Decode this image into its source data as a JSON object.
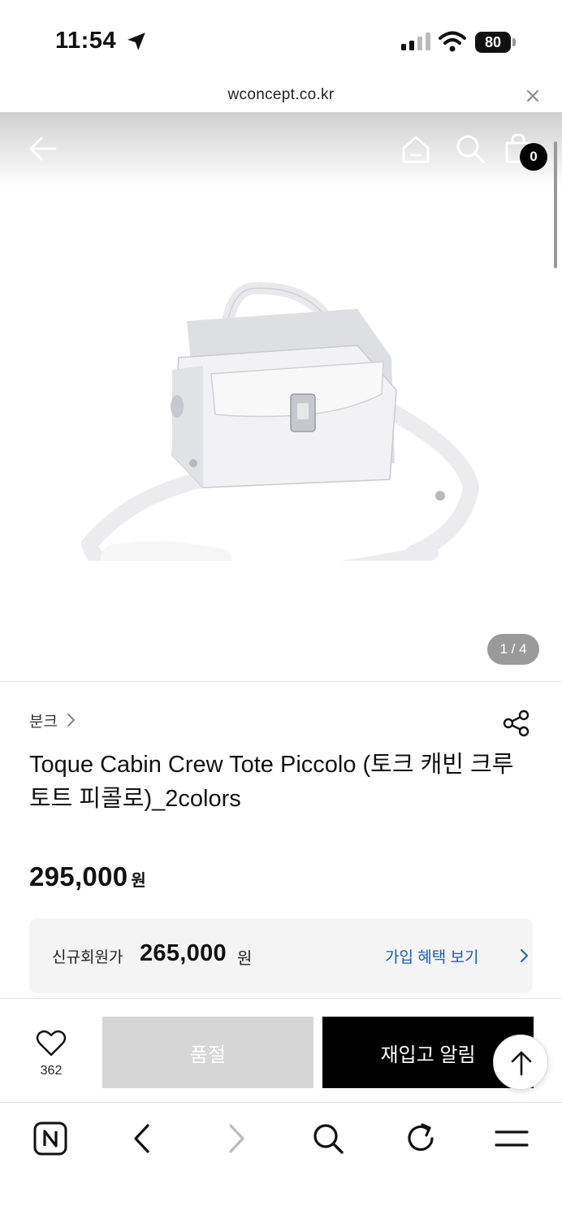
{
  "status_bar": {
    "time": "11:54",
    "battery": "80"
  },
  "browser": {
    "url": "wconcept.co.kr"
  },
  "nav": {
    "cart_count": "0"
  },
  "gallery": {
    "page_indicator": "1 / 4",
    "current_index": 1,
    "total": 4
  },
  "product": {
    "brand": "분크",
    "title": "Toque Cabin Crew Tote Piccolo (토크 캐빈 크루 토트 피콜로)_2colors",
    "price": "295,000",
    "price_unit": "원",
    "member_label": "신규회원가",
    "member_price": "265,000",
    "member_unit": "원",
    "member_link": "가입 혜택 보기"
  },
  "actions": {
    "wish_count": "362",
    "soldout_label": "품절",
    "restock_label": "재입고 알림"
  },
  "colors": {
    "accent_link": "#1a5dbf",
    "soldout_bg": "#d6d6d6",
    "restock_bg": "#000000"
  },
  "icons": [
    "location-arrow-icon",
    "signal-icon",
    "wifi-icon",
    "battery-icon",
    "close-icon",
    "back-arrow-icon",
    "home-icon",
    "search-icon",
    "cart-icon",
    "chevron-right-icon",
    "share-icon",
    "heart-icon",
    "arrow-up-icon",
    "naver-icon",
    "refresh-icon",
    "menu-icon"
  ]
}
